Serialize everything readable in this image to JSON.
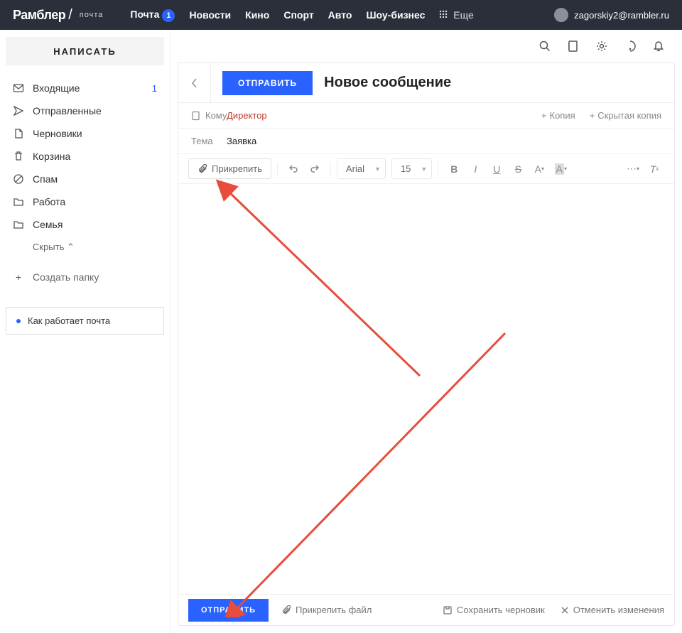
{
  "topbar": {
    "logo": "Рамблер",
    "logo_sub": "почта",
    "nav": {
      "mail": "Почта",
      "mail_badge": "1",
      "news": "Новости",
      "cinema": "Кино",
      "sport": "Спорт",
      "auto": "Авто",
      "showbiz": "Шоу-бизнес",
      "more": "Еще"
    },
    "user_email": "zagorskiy2@rambler.ru"
  },
  "sidebar": {
    "compose_label": "НАПИСАТЬ",
    "folders": {
      "inbox": {
        "label": "Входящие",
        "count": "1"
      },
      "sent": {
        "label": "Отправленные"
      },
      "drafts": {
        "label": "Черновики"
      },
      "trash": {
        "label": "Корзина"
      },
      "spam": {
        "label": "Спам"
      },
      "work": {
        "label": "Работа"
      },
      "family": {
        "label": "Семья"
      }
    },
    "hide_label": "Скрыть",
    "create_folder_label": "Создать папку",
    "help_label": "Как работает почта"
  },
  "compose": {
    "send_label": "ОТПРАВИТЬ",
    "title": "Новое сообщение",
    "to_label": "Кому",
    "to_value": "Директор",
    "cc_label": "Копия",
    "bcc_label": "Скрытая копия",
    "subject_label": "Тема",
    "subject_value": "Заявка",
    "attach_label": "Прикрепить",
    "font_name": "Arial",
    "font_size": "15",
    "bottom_send": "ОТПРАВИТЬ",
    "bottom_attach": "Прикрепить файл",
    "save_draft": "Сохранить черновик",
    "cancel_changes": "Отменить изменения"
  }
}
